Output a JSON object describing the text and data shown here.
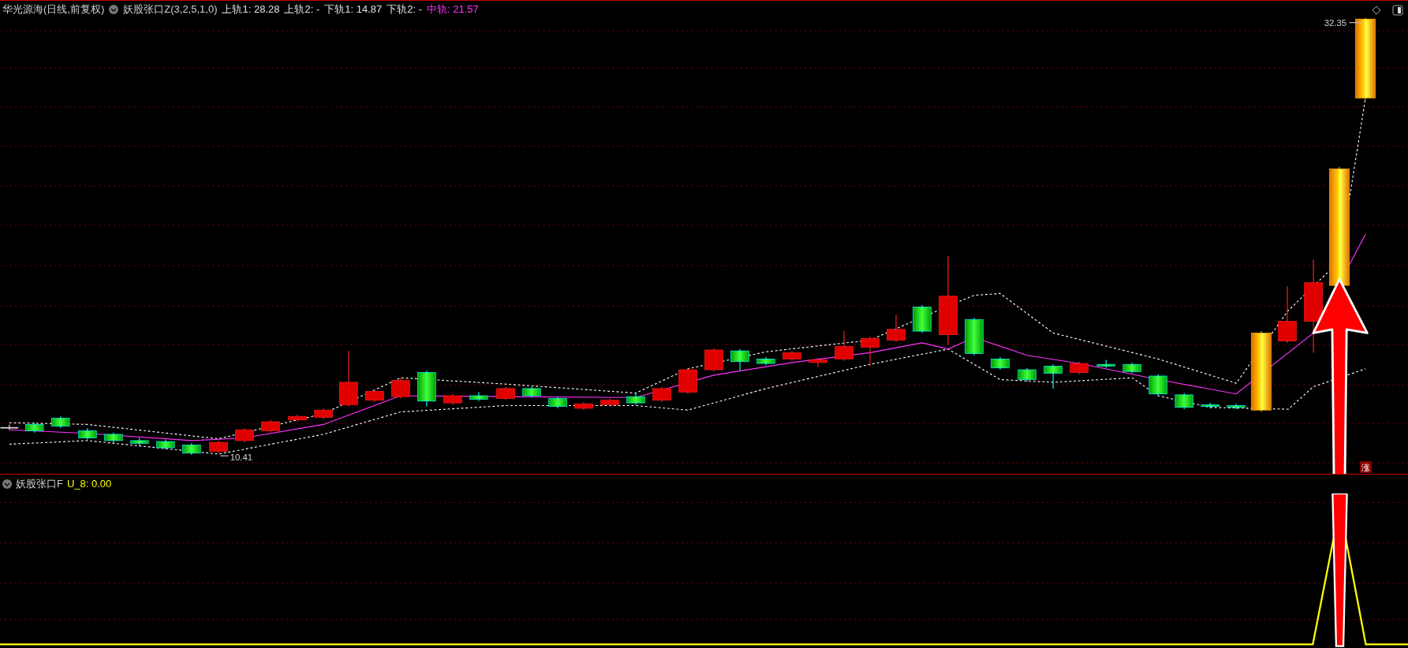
{
  "header": {
    "stock": "华光源海(日线,前复权)",
    "indicator": "妖股张口Z(3,2,5,1,0)",
    "values": [
      {
        "label": "上轨1: 28.28",
        "kind": "plain"
      },
      {
        "label": "上轨2: -",
        "kind": "plain"
      },
      {
        "label": "下轨1: 14.87",
        "kind": "plain"
      },
      {
        "label": "下轨2: -",
        "kind": "plain"
      },
      {
        "label": "中轨: 21.57",
        "kind": "mid"
      }
    ]
  },
  "main_chart": {
    "high_label": "32.35",
    "low_label": "10.41",
    "badge": "涨"
  },
  "sub_pane": {
    "indicator": "妖股张口F",
    "value": "U_8: 0.00"
  }
}
